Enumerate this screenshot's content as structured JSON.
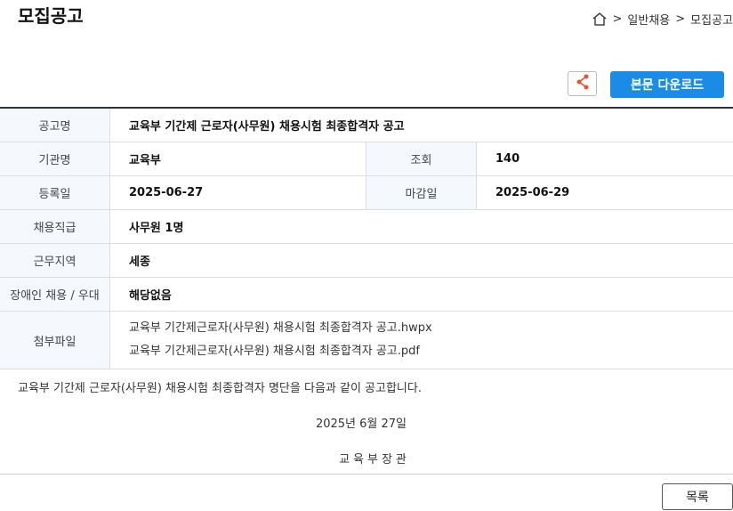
{
  "header": {
    "title": "모집공고",
    "breadcrumb": [
      {
        "sep": ">",
        "label": "일반채용"
      },
      {
        "sep": ">",
        "label": "모집공고"
      }
    ]
  },
  "actions": {
    "share_icon": "share-icon",
    "download_label": "본문 다운로드",
    "accent_color": "#1a8ce6"
  },
  "info": {
    "title_label": "공고명",
    "title_value": "교육부 기간제 근로자(사무원) 채용시험 최종합격자 공고",
    "org_label": "기관명",
    "org_value": "교육부",
    "views_label": "조회",
    "views_value": "140",
    "reg_label": "등록일",
    "reg_value": "2025-06-27",
    "deadline_label": "마감일",
    "deadline_value": "2025-06-29",
    "position_label": "채용직급",
    "position_value": "사무원 1명",
    "location_label": "근무지역",
    "location_value": "세종",
    "disability_label": "장애인 채용 / 우대",
    "disability_value": "해당없음",
    "attach_label": "첨부파일",
    "attachments": [
      "교육부 기간제근로자(사무원) 채용시험 최종합격자 공고.hwpx",
      "교육부 기간제근로자(사무원) 채용시험 최종합격자 공고.pdf"
    ]
  },
  "body": {
    "text": "교육부 기간제 근로자(사무원) 채용시험 최종합격자 명단을 다음과 같이 공고합니다.",
    "date": "2025년 6월 27일",
    "signature": "교육부장관"
  },
  "footer": {
    "list_label": "목록"
  }
}
